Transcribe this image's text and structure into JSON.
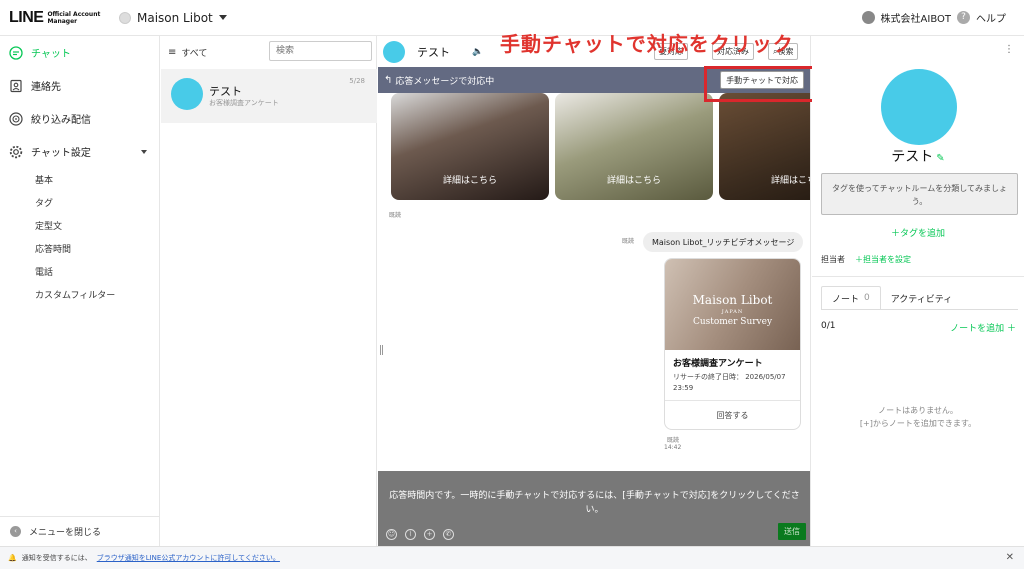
{
  "header": {
    "logo_main": "LINE",
    "logo_sub_1": "Official Account",
    "logo_sub_2": "Manager",
    "account_name": "Maison Libot",
    "company": "株式会社AIBOT",
    "help": "ヘルプ"
  },
  "sidebar": {
    "items": [
      {
        "label": "チャット",
        "icon": "chat-bubble-icon"
      },
      {
        "label": "連絡先",
        "icon": "contact-book-icon"
      },
      {
        "label": "絞り込み配信",
        "icon": "target-icon"
      },
      {
        "label": "チャット設定",
        "icon": "gear-icon"
      }
    ],
    "subitems": [
      "基本",
      "タグ",
      "定型文",
      "応答時間",
      "電話",
      "カスタムフィルター"
    ],
    "collapse_label": "メニューを閉じる"
  },
  "chatlist": {
    "filter_label": "すべて",
    "search_placeholder": "検索",
    "chats": [
      {
        "name": "テスト",
        "preview": "お客様調査アンケート",
        "date": "5/28"
      }
    ]
  },
  "chat": {
    "title": "テスト",
    "header_buttons": [
      "要対応",
      "対応済み",
      "検索"
    ],
    "banner_text": "応答メッセージで対応中",
    "manual_button": "手動チャットで対応",
    "carousel_label": "詳細はこちら",
    "read_label": "既読",
    "bubble_text": "Maison Libot_リッチビデオメッセージ",
    "survey": {
      "image_title": "Maison Libot",
      "image_sub": "JAPAN",
      "image_caption": "Customer Survey",
      "title": "お客様調査アンケート",
      "meta_line1": "リサーチの終了日時： 2026/05/07",
      "meta_line2": "23:59",
      "answer": "回答する"
    },
    "time": "14:42",
    "composer_line1": "応答時間内です。一時的に手動チャットで対応するには、[手動チャットで対応]をクリックしてくださ",
    "composer_line2": "い。",
    "send_label": "送信"
  },
  "annotation": {
    "text": "手動チャットで対応をクリック",
    "color": "#e0342e"
  },
  "profile": {
    "name": "テスト",
    "tag_hint": "タグを使ってチャットルームを分類してみましょう。",
    "add_tag": "＋タグを追加",
    "assignee_label": "担当者",
    "add_assignee": "＋担当者を設定",
    "tabs": [
      {
        "label": "ノート",
        "count": "0"
      },
      {
        "label": "アクティビティ",
        "count": ""
      }
    ],
    "note_count": "0/1",
    "add_note": "ノートを追加 ＋",
    "empty_line1": "ノートはありません。",
    "empty_line2": "[+]からノートを追加できます。"
  },
  "notification": {
    "prefix": "通知を受信するには、",
    "link": "ブラウザ通知をLINE公式アカウントに許可してください。"
  },
  "colors": {
    "accent_green": "#06c755",
    "avatar_blue": "#48cbe8",
    "banner": "#636a82"
  }
}
